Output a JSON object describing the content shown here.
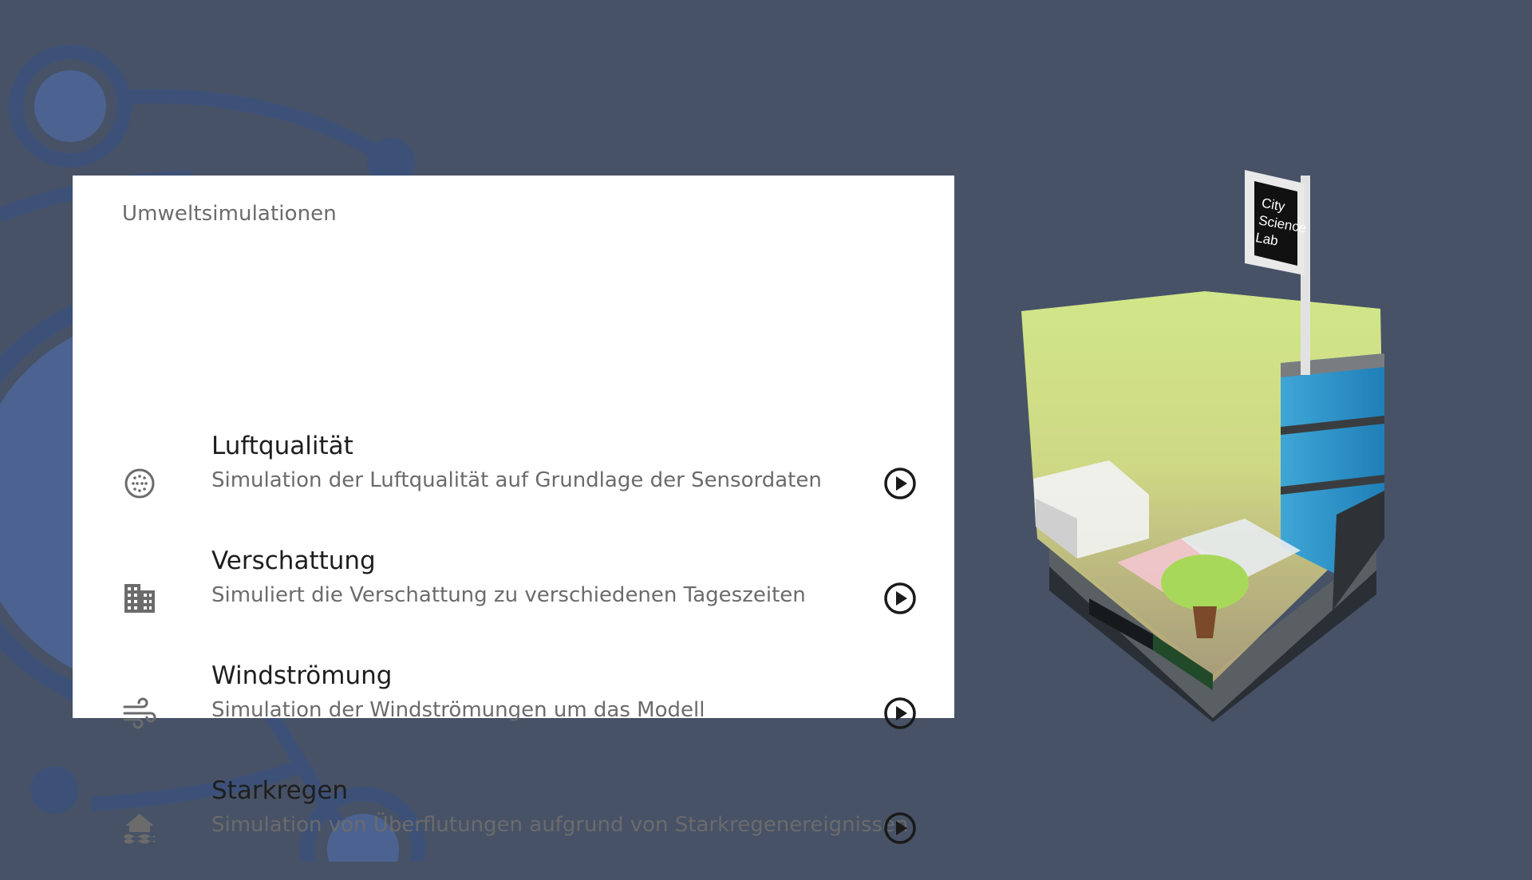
{
  "panel": {
    "title": "Umweltsimulationen",
    "items": [
      {
        "name": "Luftqualität",
        "description": "Simulation der Luftqualität auf Grundlage der Sensordaten",
        "icon": "air-quality-icon"
      },
      {
        "name": "Verschattung",
        "description": "Simuliert die Verschattung zu verschiedenen Tageszeiten",
        "icon": "building-icon"
      },
      {
        "name": "Windströmung",
        "description": "Simulation der Windströmungen um das Modell",
        "icon": "wind-icon"
      },
      {
        "name": "Starkregen",
        "description": "Simulation von Überflutungen aufgrund von Starkregenereignissen",
        "icon": "flood-icon"
      }
    ],
    "play_icon": "play-circle-icon"
  },
  "model_sign": {
    "line1": "City",
    "line2": "Science",
    "line3": "Lab"
  },
  "colors": {
    "background": "#475267",
    "decoration": "#3d5178",
    "panel": "#ffffff",
    "icon": "#6b6b6b",
    "play": "#1a1a1a"
  }
}
